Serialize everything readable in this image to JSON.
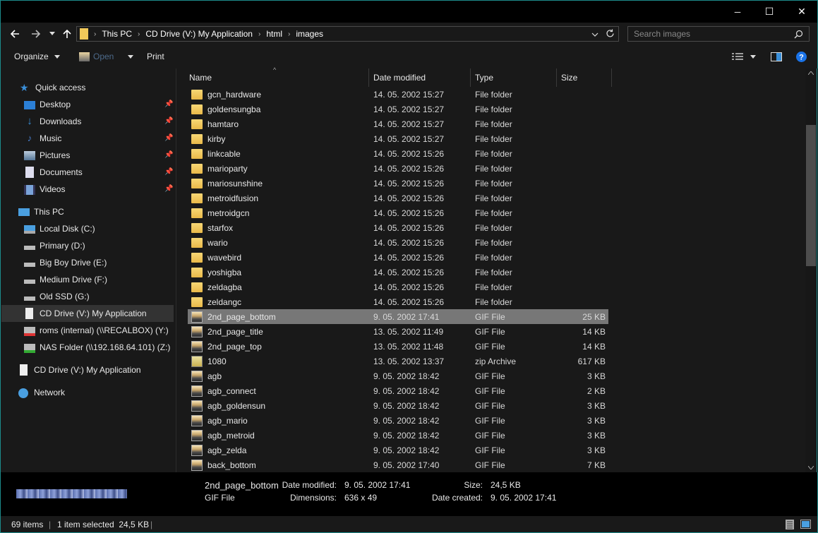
{
  "window": {
    "minimize_glyph": "─",
    "maximize_glyph": "☐",
    "close_glyph": "✕"
  },
  "address": {
    "crumbs": [
      "This PC",
      "CD Drive (V:) My Application",
      "html",
      "images"
    ],
    "search_placeholder": "Search images"
  },
  "commands": {
    "organize": "Organize",
    "open": "Open",
    "print": "Print"
  },
  "nav": {
    "quick_access": "Quick access",
    "pinned": [
      "Desktop",
      "Downloads",
      "Music",
      "Pictures",
      "Documents",
      "Videos"
    ],
    "this_pc": "This PC",
    "drives": [
      "Local Disk (C:)",
      "Primary (D:)",
      "Big Boy Drive (E:)",
      "Medium Drive (F:)",
      "Old SSD (G:)",
      "CD Drive (V:) My Application",
      "roms (internal) (\\\\RECALBOX) (Y:)",
      "NAS Folder (\\\\192.168.64.101) (Z:)"
    ],
    "cd_drive": "CD Drive (V:) My Application",
    "network": "Network"
  },
  "columns": {
    "name": "Name",
    "date": "Date modified",
    "type": "Type",
    "size": "Size"
  },
  "files": [
    {
      "name": "gcn_hardware",
      "date": "14. 05. 2002 15:27",
      "type": "File folder",
      "size": "",
      "icon": "folder-icon"
    },
    {
      "name": "goldensungba",
      "date": "14. 05. 2002 15:27",
      "type": "File folder",
      "size": "",
      "icon": "folder-icon"
    },
    {
      "name": "hamtaro",
      "date": "14. 05. 2002 15:27",
      "type": "File folder",
      "size": "",
      "icon": "folder-icon"
    },
    {
      "name": "kirby",
      "date": "14. 05. 2002 15:27",
      "type": "File folder",
      "size": "",
      "icon": "folder-icon"
    },
    {
      "name": "linkcable",
      "date": "14. 05. 2002 15:26",
      "type": "File folder",
      "size": "",
      "icon": "folder-icon"
    },
    {
      "name": "marioparty",
      "date": "14. 05. 2002 15:26",
      "type": "File folder",
      "size": "",
      "icon": "folder-icon"
    },
    {
      "name": "mariosunshine",
      "date": "14. 05. 2002 15:26",
      "type": "File folder",
      "size": "",
      "icon": "folder-icon"
    },
    {
      "name": "metroidfusion",
      "date": "14. 05. 2002 15:26",
      "type": "File folder",
      "size": "",
      "icon": "folder-icon"
    },
    {
      "name": "metroidgcn",
      "date": "14. 05. 2002 15:26",
      "type": "File folder",
      "size": "",
      "icon": "folder-icon"
    },
    {
      "name": "starfox",
      "date": "14. 05. 2002 15:26",
      "type": "File folder",
      "size": "",
      "icon": "folder-icon"
    },
    {
      "name": "wario",
      "date": "14. 05. 2002 15:26",
      "type": "File folder",
      "size": "",
      "icon": "folder-icon"
    },
    {
      "name": "wavebird",
      "date": "14. 05. 2002 15:26",
      "type": "File folder",
      "size": "",
      "icon": "folder-icon"
    },
    {
      "name": "yoshigba",
      "date": "14. 05. 2002 15:26",
      "type": "File folder",
      "size": "",
      "icon": "folder-icon"
    },
    {
      "name": "zeldagba",
      "date": "14. 05. 2002 15:26",
      "type": "File folder",
      "size": "",
      "icon": "folder-icon"
    },
    {
      "name": "zeldangc",
      "date": "14. 05. 2002 15:26",
      "type": "File folder",
      "size": "",
      "icon": "folder-icon"
    },
    {
      "name": "2nd_page_bottom",
      "date": "9. 05. 2002 17:41",
      "type": "GIF File",
      "size": "25 KB",
      "icon": "gif-icon",
      "selected": true
    },
    {
      "name": "2nd_page_title",
      "date": "13. 05. 2002 11:49",
      "type": "GIF File",
      "size": "14 KB",
      "icon": "gif-icon"
    },
    {
      "name": "2nd_page_top",
      "date": "13. 05. 2002 11:48",
      "type": "GIF File",
      "size": "14 KB",
      "icon": "gif-icon"
    },
    {
      "name": "1080",
      "date": "13. 05. 2002 13:37",
      "type": "zip Archive",
      "size": "617 KB",
      "icon": "zip-icon"
    },
    {
      "name": "agb",
      "date": "9. 05. 2002 18:42",
      "type": "GIF File",
      "size": "3 KB",
      "icon": "gif-icon"
    },
    {
      "name": "agb_connect",
      "date": "9. 05. 2002 18:42",
      "type": "GIF File",
      "size": "2 KB",
      "icon": "gif-icon"
    },
    {
      "name": "agb_goldensun",
      "date": "9. 05. 2002 18:42",
      "type": "GIF File",
      "size": "3 KB",
      "icon": "gif-icon"
    },
    {
      "name": "agb_mario",
      "date": "9. 05. 2002 18:42",
      "type": "GIF File",
      "size": "3 KB",
      "icon": "gif-icon"
    },
    {
      "name": "agb_metroid",
      "date": "9. 05. 2002 18:42",
      "type": "GIF File",
      "size": "3 KB",
      "icon": "gif-icon"
    },
    {
      "name": "agb_zelda",
      "date": "9. 05. 2002 18:42",
      "type": "GIF File",
      "size": "3 KB",
      "icon": "gif-icon"
    },
    {
      "name": "back_bottom",
      "date": "9. 05. 2002 17:40",
      "type": "GIF File",
      "size": "7 KB",
      "icon": "gif-icon"
    }
  ],
  "details": {
    "name": "2nd_page_bottom",
    "type": "GIF File",
    "date_modified_label": "Date modified:",
    "date_modified": "9. 05. 2002 17:41",
    "dimensions_label": "Dimensions:",
    "dimensions": "636 x 49",
    "size_label": "Size:",
    "size": "24,5 KB",
    "date_created_label": "Date created:",
    "date_created": "9. 05. 2002 17:41"
  },
  "status": {
    "items": "69 items",
    "selected": "1 item selected  24,5 KB"
  },
  "colors": {
    "accent_border": "#1c8b8b",
    "selection": "#777777",
    "help_blue": "#1a73e8"
  }
}
